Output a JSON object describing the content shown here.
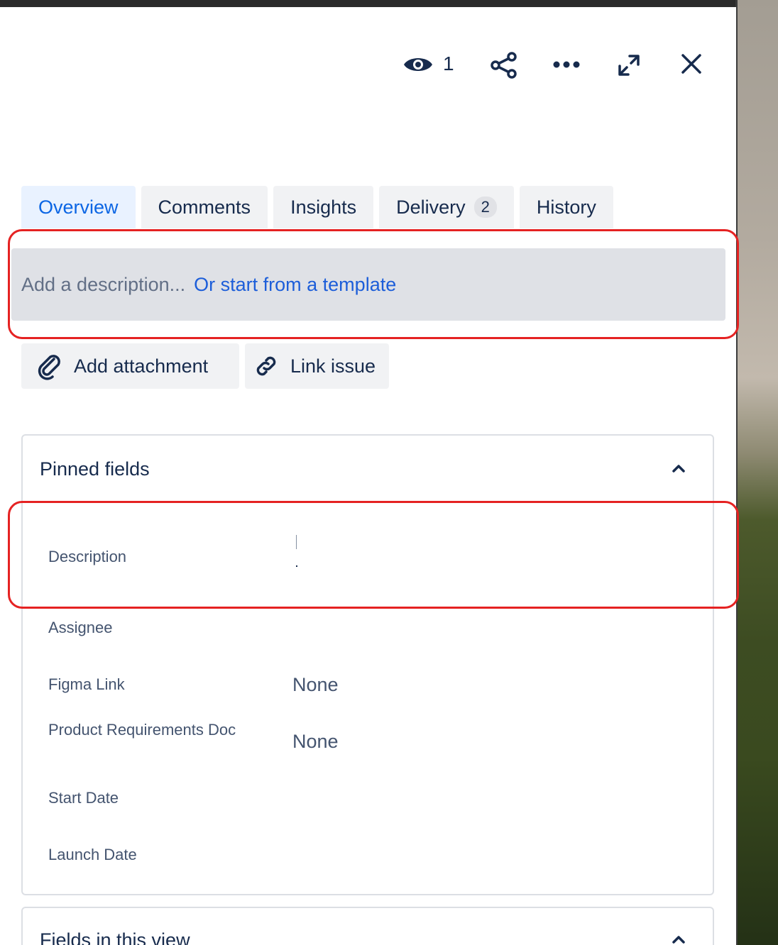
{
  "header": {
    "watch_icon": "eye-icon",
    "watch_count": "1",
    "share_icon": "share-icon",
    "more_icon": "more-icon",
    "expand_icon": "expand-icon",
    "close_icon": "close-icon"
  },
  "tabs": [
    {
      "label": "Overview",
      "active": true
    },
    {
      "label": "Comments"
    },
    {
      "label": "Insights"
    },
    {
      "label": "Delivery",
      "badge": "2"
    },
    {
      "label": "History"
    }
  ],
  "description": {
    "placeholder": "Add a description...",
    "template_link": "Or start from a template"
  },
  "actions": {
    "attachment_label": "Add attachment",
    "attachment_icon": "paperclip-icon",
    "link_label": "Link issue",
    "link_icon": "link-icon"
  },
  "pinned_fields": {
    "title": "Pinned fields",
    "chevron_icon": "chevron-up-icon",
    "fields": [
      {
        "label": "Description",
        "value": ""
      },
      {
        "label": "Assignee",
        "value": ""
      },
      {
        "label": "Figma Link",
        "value": "None"
      },
      {
        "label": "Product Requirements Doc",
        "value": "None"
      },
      {
        "label": "Start Date",
        "value": ""
      },
      {
        "label": "Launch Date",
        "value": ""
      }
    ]
  },
  "view_fields": {
    "title": "Fields in this view",
    "chevron_icon": "chevron-up-icon"
  },
  "colors": {
    "accent": "#0c66e4",
    "link": "#1d5ed9",
    "highlight": "#e52222",
    "text": "#172b4d",
    "muted": "#44546f"
  }
}
